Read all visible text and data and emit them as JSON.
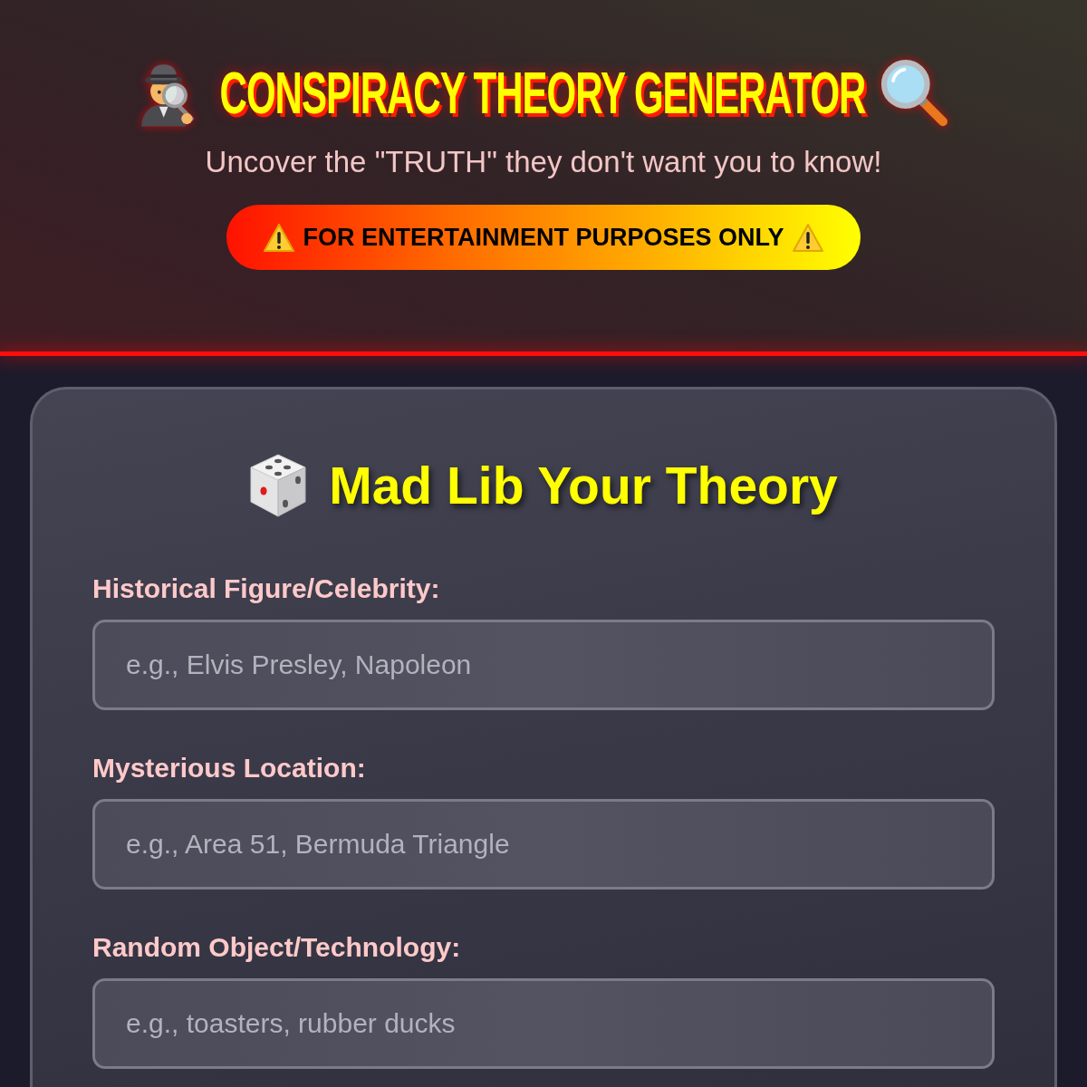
{
  "header": {
    "title": "CONSPIRACY THEORY GENERATOR",
    "subtitle": "Uncover the \"TRUTH\" they don't want you to know!",
    "disclaimer": "FOR ENTERTAINMENT PURPOSES ONLY"
  },
  "form": {
    "title": "Mad Lib Your Theory",
    "fields": [
      {
        "label": "Historical Figure/Celebrity:",
        "placeholder": "e.g., Elvis Presley, Napoleon"
      },
      {
        "label": "Mysterious Location:",
        "placeholder": "e.g., Area 51, Bermuda Triangle"
      },
      {
        "label": "Random Object/Technology:",
        "placeholder": "e.g., toasters, rubber ducks"
      }
    ]
  }
}
